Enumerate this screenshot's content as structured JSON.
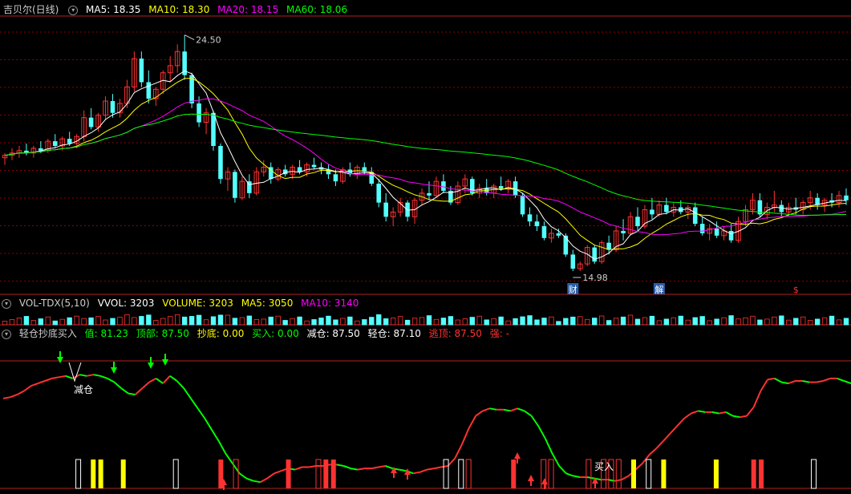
{
  "colors": {
    "bg": "#000000",
    "up": "#ff3232",
    "down": "#54ffff",
    "ma5": "#ffffff",
    "ma10": "#ffff00",
    "ma20": "#ff00ff",
    "ma60": "#00ff00",
    "grid": "#8b0000",
    "label": "#cccccc"
  },
  "main_header": {
    "title": "吉贝尔(日线)",
    "items": [
      {
        "label": "MA5: 18.35",
        "color": "#ffffff"
      },
      {
        "label": "MA10: 18.30",
        "color": "#ffff00"
      },
      {
        "label": "MA20: 18.15",
        "color": "#ff00ff"
      },
      {
        "label": "MA60: 18.06",
        "color": "#00ff00"
      }
    ]
  },
  "vol_header": {
    "title": "VOL-TDX(5,10)",
    "items": [
      {
        "label": "VVOL: 3203",
        "color": "#ffffff"
      },
      {
        "label": "VOLUME: 3203",
        "color": "#ffff00"
      },
      {
        "label": "MA5: 3050",
        "color": "#ffff00"
      },
      {
        "label": "MA10: 3140",
        "color": "#ff00ff"
      }
    ]
  },
  "ind_header": {
    "title": "轻仓抄底买入",
    "items": [
      {
        "label": "值: 81.23",
        "color": "#00ff00"
      },
      {
        "label": "顶部: 87.50",
        "color": "#00ff00"
      },
      {
        "label": "抄底: 0.00",
        "color": "#ffff00"
      },
      {
        "label": "买入: 0.00",
        "color": "#00ff00"
      },
      {
        "label": "减仓: 87.50",
        "color": "#ffffff"
      },
      {
        "label": "轻仓: 87.10",
        "color": "#ffffff"
      },
      {
        "label": "逃顶: 87.50",
        "color": "#ff3232"
      },
      {
        "label": "强: -",
        "color": "#ff3232"
      }
    ]
  },
  "price_annotations": {
    "high": "24.50",
    "low": "14.98"
  },
  "event_markers": [
    {
      "label": "财",
      "color": "#ffffff",
      "bg": "#2b5ea8"
    },
    {
      "label": "解",
      "color": "#ffffff",
      "bg": "#2b5ea8"
    },
    {
      "label": "$",
      "color": "#ff3232",
      "bg": ""
    }
  ],
  "signal_labels": {
    "reduce": "减仓",
    "buy": "买入"
  },
  "chart_data": [
    {
      "type": "candlestick",
      "title": "吉贝尔(日线)",
      "ylim": [
        14.5,
        25.2
      ],
      "series": [
        {
          "name": "MA5",
          "last": 18.35
        },
        {
          "name": "MA10",
          "last": 18.3
        },
        {
          "name": "MA20",
          "last": 18.15
        },
        {
          "name": "MA60",
          "last": 18.06
        }
      ],
      "candles": [
        [
          19.3,
          19.5,
          19.0,
          19.4
        ],
        [
          19.4,
          19.7,
          19.2,
          19.5
        ],
        [
          19.5,
          19.8,
          19.3,
          19.6
        ],
        [
          19.6,
          19.9,
          19.4,
          19.5
        ],
        [
          19.5,
          19.8,
          19.3,
          19.7
        ],
        [
          19.7,
          20.0,
          19.5,
          19.6
        ],
        [
          19.6,
          20.1,
          19.5,
          20.0
        ],
        [
          20.0,
          20.3,
          19.7,
          19.8
        ],
        [
          19.8,
          20.2,
          19.6,
          20.1
        ],
        [
          20.1,
          20.4,
          19.8,
          19.9
        ],
        [
          19.9,
          20.3,
          19.7,
          20.2
        ],
        [
          20.2,
          21.3,
          20.0,
          21.0
        ],
        [
          21.0,
          21.4,
          20.5,
          20.6
        ],
        [
          20.6,
          21.2,
          20.4,
          21.1
        ],
        [
          21.1,
          21.9,
          20.9,
          21.7
        ],
        [
          21.7,
          22.0,
          21.0,
          21.2
        ],
        [
          21.2,
          21.8,
          21.0,
          21.6
        ],
        [
          21.6,
          22.6,
          21.4,
          22.3
        ],
        [
          22.3,
          23.8,
          22.1,
          23.5
        ],
        [
          23.5,
          23.8,
          22.3,
          22.5
        ],
        [
          22.5,
          23.0,
          21.6,
          21.8
        ],
        [
          21.8,
          22.3,
          21.5,
          22.2
        ],
        [
          22.2,
          23.0,
          22.0,
          22.9
        ],
        [
          22.9,
          23.6,
          22.5,
          23.2
        ],
        [
          23.2,
          24.1,
          22.9,
          23.8
        ],
        [
          23.8,
          24.5,
          22.6,
          22.8
        ],
        [
          22.8,
          22.9,
          21.4,
          21.6
        ],
        [
          21.6,
          21.9,
          20.6,
          20.8
        ],
        [
          20.8,
          21.4,
          20.3,
          21.2
        ],
        [
          21.2,
          21.3,
          19.6,
          19.8
        ],
        [
          19.8,
          19.9,
          18.2,
          18.4
        ],
        [
          18.4,
          18.9,
          17.9,
          18.7
        ],
        [
          18.7,
          18.8,
          17.4,
          17.6
        ],
        [
          17.6,
          18.5,
          17.5,
          18.3
        ],
        [
          18.3,
          18.6,
          17.6,
          17.8
        ],
        [
          17.8,
          18.9,
          17.7,
          18.7
        ],
        [
          18.7,
          19.2,
          18.5,
          18.9
        ],
        [
          18.9,
          19.1,
          18.2,
          18.4
        ],
        [
          18.4,
          18.9,
          18.3,
          18.8
        ],
        [
          18.8,
          19.0,
          18.5,
          18.6
        ],
        [
          18.6,
          19.0,
          18.4,
          18.9
        ],
        [
          18.9,
          19.2,
          18.6,
          18.7
        ],
        [
          18.7,
          19.1,
          18.5,
          19.0
        ],
        [
          19.0,
          19.3,
          18.8,
          18.9
        ],
        [
          18.9,
          19.1,
          18.6,
          18.8
        ],
        [
          18.8,
          19.0,
          18.4,
          18.6
        ],
        [
          18.6,
          18.8,
          18.1,
          18.3
        ],
        [
          18.3,
          18.9,
          18.2,
          18.8
        ],
        [
          18.8,
          19.1,
          18.5,
          18.6
        ],
        [
          18.6,
          19.0,
          18.4,
          18.9
        ],
        [
          18.9,
          19.1,
          18.6,
          18.7
        ],
        [
          18.7,
          18.9,
          18.1,
          18.2
        ],
        [
          18.2,
          18.4,
          17.2,
          17.4
        ],
        [
          17.4,
          17.8,
          16.6,
          16.8
        ],
        [
          16.8,
          17.2,
          16.4,
          17.0
        ],
        [
          17.0,
          17.6,
          16.8,
          17.4
        ],
        [
          17.4,
          17.5,
          16.6,
          16.8
        ],
        [
          16.8,
          17.6,
          16.5,
          17.5
        ],
        [
          17.5,
          18.0,
          17.3,
          17.8
        ],
        [
          17.8,
          18.3,
          17.5,
          17.7
        ],
        [
          17.7,
          18.5,
          17.6,
          18.3
        ],
        [
          18.3,
          18.6,
          17.8,
          17.9
        ],
        [
          17.9,
          18.1,
          17.3,
          17.4
        ],
        [
          17.4,
          18.3,
          17.3,
          18.1
        ],
        [
          18.1,
          18.6,
          17.8,
          18.4
        ],
        [
          18.4,
          18.5,
          17.7,
          17.8
        ],
        [
          17.8,
          18.2,
          17.6,
          18.0
        ],
        [
          18.0,
          18.4,
          17.7,
          17.8
        ],
        [
          17.8,
          18.2,
          17.6,
          18.1
        ],
        [
          18.1,
          18.5,
          17.9,
          18.0
        ],
        [
          18.0,
          18.4,
          17.8,
          18.3
        ],
        [
          18.3,
          18.5,
          17.6,
          17.7
        ],
        [
          17.7,
          17.8,
          16.8,
          16.9
        ],
        [
          16.9,
          17.2,
          16.4,
          16.6
        ],
        [
          16.6,
          16.9,
          16.2,
          16.4
        ],
        [
          16.4,
          16.6,
          15.8,
          15.9
        ],
        [
          15.9,
          16.3,
          15.7,
          16.1
        ],
        [
          16.1,
          16.3,
          15.9,
          16.0
        ],
        [
          16.0,
          16.1,
          15.1,
          15.2
        ],
        [
          15.2,
          15.4,
          14.5,
          14.6
        ],
        [
          14.6,
          14.9,
          14.5,
          14.8
        ],
        [
          14.8,
          15.6,
          14.7,
          15.5
        ],
        [
          15.5,
          15.6,
          14.8,
          14.9
        ],
        [
          14.9,
          15.8,
          14.8,
          15.7
        ],
        [
          15.7,
          16.0,
          15.2,
          15.4
        ],
        [
          15.4,
          16.4,
          15.3,
          16.2
        ],
        [
          16.2,
          16.7,
          15.8,
          16.1
        ],
        [
          16.1,
          17.0,
          16.0,
          16.8
        ],
        [
          16.8,
          17.2,
          16.2,
          16.4
        ],
        [
          16.4,
          17.3,
          16.3,
          17.1
        ],
        [
          17.1,
          17.6,
          16.7,
          16.9
        ],
        [
          16.9,
          17.5,
          16.8,
          17.3
        ],
        [
          17.3,
          17.6,
          16.9,
          17.0
        ],
        [
          17.0,
          17.4,
          16.8,
          17.2
        ],
        [
          17.2,
          17.5,
          16.9,
          17.0
        ],
        [
          17.0,
          17.3,
          16.7,
          17.2
        ],
        [
          17.2,
          17.4,
          16.4,
          16.5
        ],
        [
          16.5,
          16.8,
          16.0,
          16.1
        ],
        [
          16.1,
          16.5,
          15.8,
          16.3
        ],
        [
          16.3,
          16.6,
          15.9,
          16.0
        ],
        [
          16.0,
          16.4,
          15.8,
          16.2
        ],
        [
          16.2,
          16.5,
          15.7,
          15.8
        ],
        [
          15.8,
          16.8,
          15.7,
          16.6
        ],
        [
          16.6,
          17.3,
          16.4,
          17.1
        ],
        [
          17.1,
          17.8,
          16.9,
          17.5
        ],
        [
          17.5,
          17.8,
          16.8,
          16.9
        ],
        [
          16.9,
          17.4,
          16.7,
          17.2
        ],
        [
          17.2,
          17.9,
          17.0,
          17.3
        ],
        [
          17.3,
          17.5,
          16.8,
          17.0
        ],
        [
          17.0,
          17.4,
          16.8,
          17.2
        ],
        [
          17.2,
          17.6,
          16.9,
          17.1
        ],
        [
          17.1,
          17.5,
          16.9,
          17.4
        ],
        [
          17.4,
          17.9,
          17.1,
          17.6
        ],
        [
          17.6,
          17.8,
          17.1,
          17.3
        ],
        [
          17.3,
          17.6,
          17.0,
          17.5
        ],
        [
          17.5,
          17.8,
          17.2,
          17.4
        ],
        [
          17.4,
          17.9,
          17.2,
          17.7
        ],
        [
          17.7,
          18.0,
          17.3,
          17.5
        ]
      ]
    },
    {
      "type": "bar",
      "title": "VOL-TDX(5,10)",
      "series": [
        {
          "name": "VVOL",
          "last": 3203
        },
        {
          "name": "VOLUME",
          "last": 3203
        },
        {
          "name": "MA5",
          "last": 3050
        },
        {
          "name": "MA10",
          "last": 3140
        }
      ]
    },
    {
      "type": "line",
      "title": "轻仓抄底买入",
      "ylim": [
        0,
        100
      ],
      "series": [
        {
          "name": "值",
          "last": 81.23
        },
        {
          "name": "顶部",
          "last": 87.5
        },
        {
          "name": "抄底",
          "last": 0.0
        },
        {
          "name": "买入",
          "last": 0.0
        },
        {
          "name": "减仓",
          "last": 87.5
        },
        {
          "name": "轻仓",
          "last": 87.1
        },
        {
          "name": "逃顶",
          "last": 87.5
        }
      ],
      "values": [
        72,
        73,
        75,
        78,
        82,
        84,
        86,
        88,
        89,
        90,
        88,
        91,
        90,
        91,
        90,
        88,
        85,
        80,
        76,
        75,
        80,
        85,
        88,
        84,
        90,
        86,
        80,
        72,
        64,
        56,
        47,
        38,
        28,
        20,
        12,
        8,
        6,
        5,
        8,
        12,
        14,
        16,
        15,
        17,
        17,
        18,
        18,
        19,
        19,
        18,
        16,
        15,
        16,
        16,
        17,
        18,
        16,
        15,
        14,
        12,
        13,
        15,
        16,
        17,
        18,
        24,
        35,
        48,
        58,
        62,
        64,
        63,
        63,
        62,
        64,
        62,
        58,
        50,
        40,
        28,
        18,
        12,
        10,
        9,
        9,
        8,
        7,
        7,
        6,
        7,
        10,
        15,
        20,
        27,
        32,
        38,
        44,
        50,
        56,
        60,
        62,
        61,
        61,
        60,
        61,
        58,
        57,
        58,
        65,
        78,
        87,
        88,
        85,
        84,
        86,
        86,
        85,
        85,
        86,
        88,
        88,
        86,
        84
      ]
    }
  ]
}
